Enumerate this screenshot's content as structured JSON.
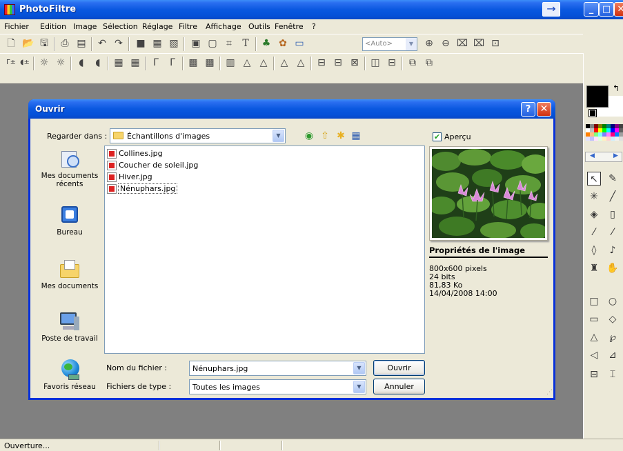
{
  "app": {
    "title": "PhotoFiltre"
  },
  "menu": [
    "Fichier",
    "Edition",
    "Image",
    "Sélection",
    "Réglage",
    "Filtre",
    "Affichage",
    "Outils",
    "Fenêtre",
    "?"
  ],
  "toolbar": {
    "zoom_value": "<Auto>"
  },
  "status": {
    "text": "Ouverture..."
  },
  "dialog": {
    "title": "Ouvrir",
    "look_in_label": "Regarder dans :",
    "look_in_value": "Échantillons d'images",
    "places": [
      {
        "label": "Mes documents récents",
        "icon": "recent-documents-icon"
      },
      {
        "label": "Bureau",
        "icon": "desktop-icon"
      },
      {
        "label": "Mes documents",
        "icon": "my-documents-icon"
      },
      {
        "label": "Poste de travail",
        "icon": "my-computer-icon"
      },
      {
        "label": "Favoris réseau",
        "icon": "network-places-icon"
      }
    ],
    "files": [
      "Collines.jpg",
      "Coucher de soleil.jpg",
      "Hiver.jpg",
      "Nénuphars.jpg"
    ],
    "selected_file": "Nénuphars.jpg",
    "filename_label": "Nom du fichier :",
    "filename_value": "Nénuphars.jpg",
    "filetype_label": "Fichiers de type :",
    "filetype_value": "Toutes les images",
    "open_button": "Ouvrir",
    "cancel_button": "Annuler",
    "preview_label": "Aperçu",
    "preview_checked": true,
    "properties_title": "Propriétés de l'image",
    "properties": [
      "800x600 pixels",
      "24 bits",
      "81,83 Ko",
      "14/04/2008 14:00"
    ]
  },
  "colors": {
    "titlebar": "#0a58e0",
    "workspace": "#808080",
    "window_bg": "#ece9d8"
  }
}
